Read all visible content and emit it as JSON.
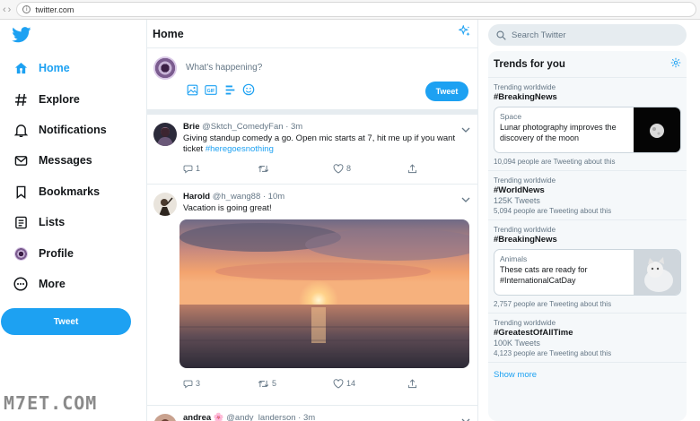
{
  "browser": {
    "url": "twitter.com"
  },
  "nav": {
    "items": [
      {
        "label": "Home",
        "icon": "home-icon"
      },
      {
        "label": "Explore",
        "icon": "hashtag-icon"
      },
      {
        "label": "Notifications",
        "icon": "bell-icon"
      },
      {
        "label": "Messages",
        "icon": "envelope-icon"
      },
      {
        "label": "Bookmarks",
        "icon": "bookmark-icon"
      },
      {
        "label": "Lists",
        "icon": "list-icon"
      },
      {
        "label": "Profile",
        "icon": "avatar"
      },
      {
        "label": "More",
        "icon": "more-icon"
      }
    ],
    "tweet_button": "Tweet"
  },
  "watermark": "M7ET.COM",
  "main": {
    "title": "Home",
    "composer": {
      "placeholder": "What's happening?",
      "tweet_button": "Tweet"
    },
    "tweets": [
      {
        "name": "Brie",
        "handle": "@Sktch_ComedyFan · 3m",
        "text": "Giving standup comedy a go. Open mic starts at 7, hit me up if you want ticket ",
        "hashtag": "#heregoesnothing",
        "replies": "1",
        "retweets": "",
        "likes": "8"
      },
      {
        "name": "Harold",
        "handle": "@h_wang88 · 10m",
        "text": "Vacation is going great!",
        "replies": "3",
        "retweets": "5",
        "likes": "14"
      },
      {
        "name": "andrea",
        "flower": "🌸",
        "handle": "@andy_landerson · 3m"
      }
    ]
  },
  "right": {
    "search_placeholder": "Search Twitter",
    "trends_title": "Trends for you",
    "trends": [
      {
        "meta": "Trending worldwide",
        "name": "#BreakingNews",
        "card": {
          "category": "Space",
          "title": "Lunar photography improves the discovery of the moon"
        },
        "footer": "10,094 people are Tweeting about this"
      },
      {
        "meta": "Trending worldwide",
        "name": "#WorldNews",
        "count": "125K Tweets",
        "footer": "5,094 people are Tweeting about this"
      },
      {
        "meta": "Trending worldwide",
        "name": "#BreakingNews",
        "card": {
          "category": "Animals",
          "title": "These cats are ready for #InternationalCatDay"
        },
        "footer": "2,757 people are Tweeting about this"
      },
      {
        "meta": "Trending worldwide",
        "name": "#GreatestOfAllTime",
        "count": "100K Tweets",
        "footer": "4,123 people are Tweeting about this"
      }
    ],
    "show_more": "Show more"
  },
  "colors": {
    "accent": "#1da1f2",
    "text": "#14171a",
    "muted": "#657786",
    "border": "#e6ecf0"
  }
}
